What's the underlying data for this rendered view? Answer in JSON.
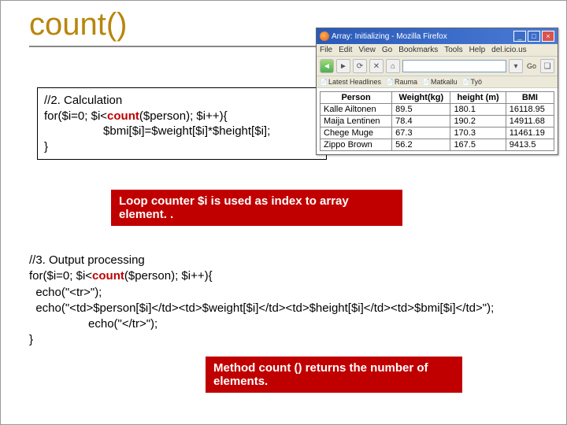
{
  "title": "count()",
  "code1": {
    "line1": "//2. Calculation",
    "line2a": "for($i=0; $i<",
    "line2_count": "count",
    "line2b": "($person); $i++){",
    "line3": "                  $bmi[$i]=$weight[$i]*$height[$i];",
    "line4": "}"
  },
  "callout1": {
    "line1": "Loop counter $i is used as index to array",
    "line2": "element. ."
  },
  "code3": {
    "line1": "//3. Output processing",
    "line2a": "for($i=0; $i<",
    "line2_count": "count",
    "line2b": "($person); $i++){",
    "line3": "  echo(\"<tr>\");",
    "line4": "  echo(\"<td>$person[$i]</td><td>$weight[$i]</td><td>$height[$i]</td><td>$bmi[$i]</td>\");",
    "line5": "                  echo(\"</tr>\");",
    "line6": "}"
  },
  "callout2": {
    "line1": "Method count () returns the number of",
    "line2": "elements."
  },
  "browser": {
    "title": "Array: Initializing - Mozilla Firefox",
    "menu": [
      "File",
      "Edit",
      "View",
      "Go",
      "Bookmarks",
      "Tools",
      "Help",
      "del.icio.us"
    ],
    "go_label": "Go",
    "bookmarks": [
      "Latest Headlines",
      "Rauma",
      "Matkailu",
      "Työ"
    ],
    "table": {
      "headers": [
        "Person",
        "Weight(kg)",
        "height (m)",
        "BMI"
      ],
      "rows": [
        [
          "Kalle Ailtonen",
          "89.5",
          "180.1",
          "16118.95"
        ],
        [
          "Maija Lentinen",
          "78.4",
          "190.2",
          "14911.68"
        ],
        [
          "Chege Muge",
          "67.3",
          "170.3",
          "11461.19"
        ],
        [
          "Zippo Brown",
          "56.2",
          "167.5",
          "9413.5"
        ]
      ]
    }
  }
}
